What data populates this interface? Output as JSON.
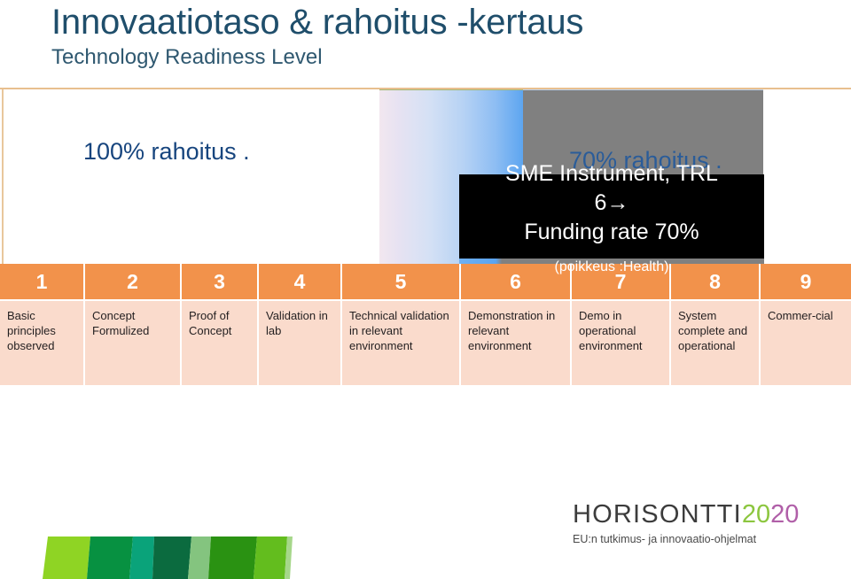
{
  "slide": {
    "title": "Innovaatiotaso & rahoitus -kertaus",
    "subtitle": "Technology Readiness Level"
  },
  "band": {
    "left_label": "100% rahoitus   .",
    "right_label": "70% rahoitus    .",
    "colors": {
      "white": "#ffffff",
      "gradient_start": "#f2e7ef",
      "gradient_end": "#5aa4f0",
      "gray_box": "#808080",
      "black_box": "#000000",
      "text_blue": "#17457e",
      "text_blue_right": "#2a5c99"
    }
  },
  "overlay": {
    "line1": "SME Instrument, TRL",
    "line2": "6→",
    "line3": "Funding rate 70%",
    "note": "(poikkeus :Health)"
  },
  "trl": {
    "number_row_color": "#f2924b",
    "desc_row_color": "#fadbcc",
    "levels": [
      {
        "number": "1",
        "description": "Basic principles observed"
      },
      {
        "number": "2",
        "description": "Concept Formulized"
      },
      {
        "number": "3",
        "description": "Proof of Concept"
      },
      {
        "number": "4",
        "description": "Validation in lab"
      },
      {
        "number": "5",
        "description": "Technical validation in relevant environment"
      },
      {
        "number": "6",
        "description": "Demonstration in relevant environment"
      },
      {
        "number": "7",
        "description": "Demo in operational environment"
      },
      {
        "number": "8",
        "description": "System complete and operational"
      },
      {
        "number": "9",
        "description": "Commer-cial"
      }
    ]
  },
  "logo": {
    "word": "HORISONTTI",
    "year_first": "20",
    "year_second": "20",
    "tagline": "EU:n tutkimus- ja innovaatio-ohjelmat",
    "green": "#8cc63f",
    "purple": "#b05fa8"
  }
}
